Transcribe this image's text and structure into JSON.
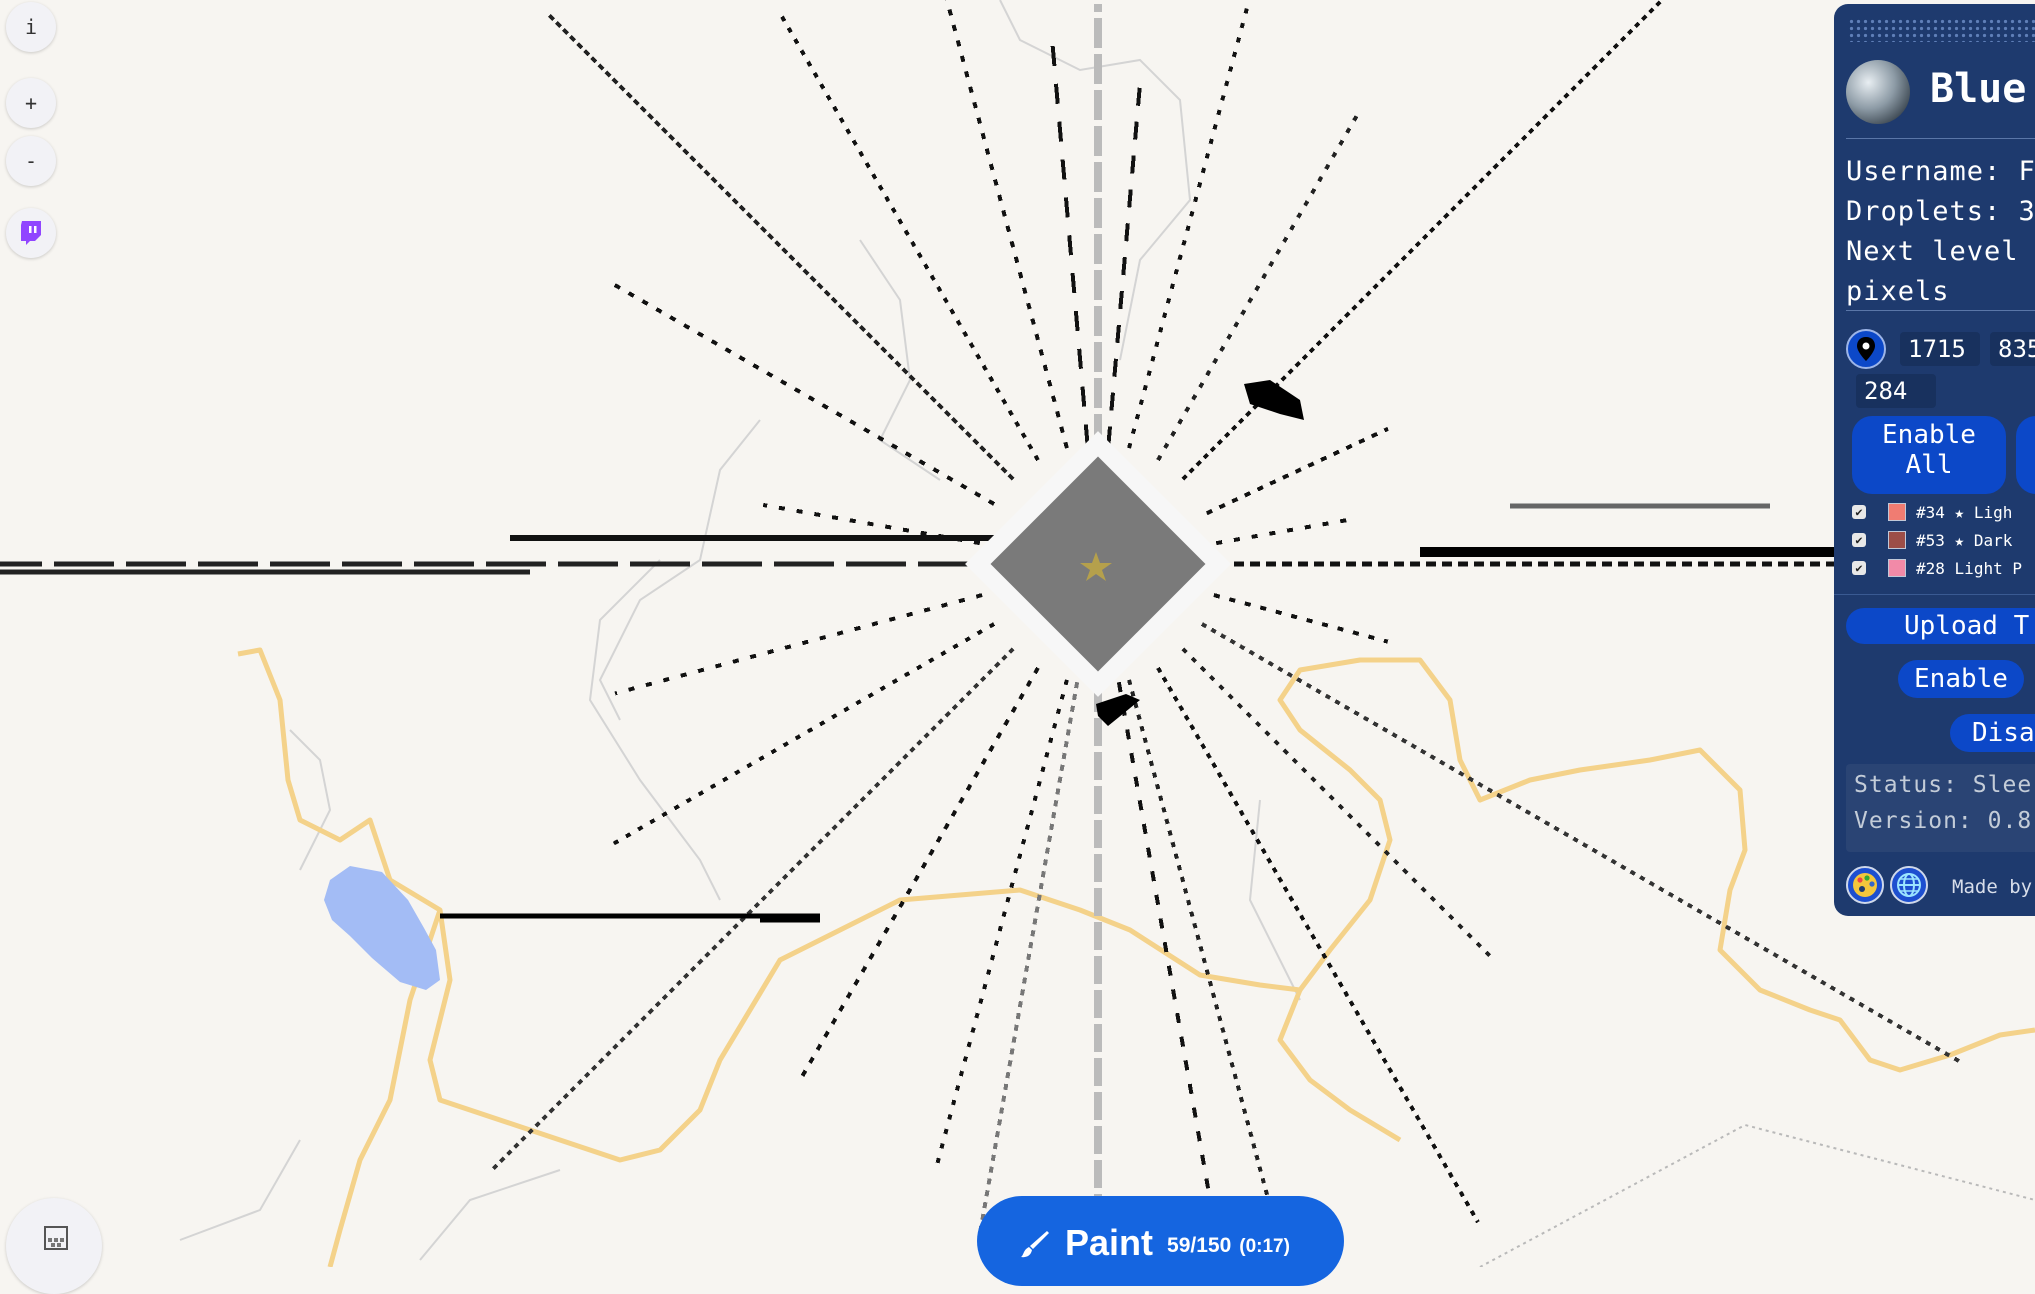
{
  "map_controls": {
    "info_label": "i",
    "zoom_in_label": "+",
    "zoom_out_label": "-"
  },
  "paint_button": {
    "label": "Paint",
    "charges": "59/150",
    "timer": "(0:17)"
  },
  "panel": {
    "title": "Blue",
    "username_line": "Username: F",
    "droplets_line": "Droplets: 3",
    "next_level_line": "Next level",
    "pixels_line": "pixels",
    "coords": [
      "1715",
      "835",
      "284"
    ],
    "enable_all_line1": "Enable",
    "enable_all_line2": "All",
    "colors": [
      {
        "id": "#34",
        "star": "★",
        "name": "Ligh",
        "hex": "#f07c72"
      },
      {
        "id": "#53",
        "star": "★",
        "name": "Dark",
        "hex": "#9c4e48"
      },
      {
        "id": "#28",
        "star": "",
        "name": "Light P",
        "hex": "#f28aa8"
      }
    ],
    "upload_label": "Upload T",
    "enable_label": "Enable",
    "disable_label": "Disa",
    "status_line": "Status: Slee",
    "version_line": "Version: 0.8",
    "made_by": "Made by"
  },
  "colors": {
    "map_bg": "#f7f5f1",
    "road": "#f4d28a",
    "water": "#a3bcf5",
    "panel_bg": "#1e3a6e",
    "accent": "#1565e0"
  }
}
